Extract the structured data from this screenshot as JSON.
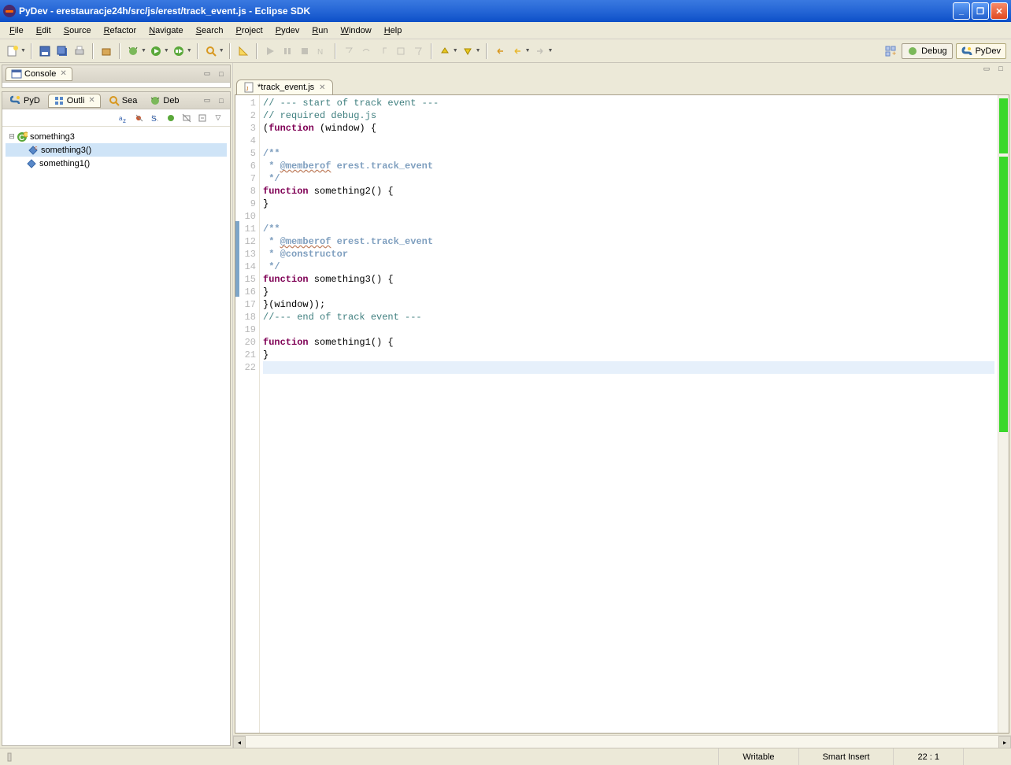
{
  "title": "PyDev - erestauracje24h/src/js/erest/track_event.js - Eclipse SDK",
  "menu": [
    "File",
    "Edit",
    "Source",
    "Refactor",
    "Navigate",
    "Search",
    "Project",
    "Pydev",
    "Run",
    "Window",
    "Help"
  ],
  "perspectives": {
    "debug": "Debug",
    "pydev": "PyDev"
  },
  "leftTop": {
    "tab": "Console"
  },
  "leftBottom": {
    "tabs": [
      "PyD",
      "Outli",
      "Sea",
      "Deb"
    ],
    "activeTab": 1,
    "tree": {
      "root": {
        "label": "something3",
        "expanded": true
      },
      "children": [
        {
          "label": "something3()",
          "selected": true,
          "kind": "constructor"
        },
        {
          "label": "something1()",
          "kind": "member"
        }
      ]
    }
  },
  "editor": {
    "tab": "*track_event.js",
    "lines": 22,
    "changed": [
      11,
      12,
      13,
      14,
      15,
      16
    ],
    "currentLine": 22,
    "code": [
      {
        "t": "cmt",
        "s": "// --- start of track event ---"
      },
      {
        "t": "cmt",
        "s": "// required debug.js"
      },
      {
        "t": "mix",
        "p": [
          [
            "",
            "("
          ],
          [
            "kw",
            "function"
          ],
          [
            "",
            " (window) {"
          ]
        ]
      },
      {
        "t": "",
        "s": ""
      },
      {
        "t": "jtag",
        "s": "/**"
      },
      {
        "t": "mix",
        "p": [
          [
            "jtag",
            " * "
          ],
          [
            "jtag-bad",
            "@memberof"
          ],
          [
            "jtag",
            " erest.track_event"
          ]
        ]
      },
      {
        "t": "jtag",
        "s": " */"
      },
      {
        "t": "mix",
        "p": [
          [
            "kw",
            "function"
          ],
          [
            "",
            " something2() {"
          ]
        ]
      },
      {
        "t": "",
        "s": "}"
      },
      {
        "t": "",
        "s": ""
      },
      {
        "t": "jtag",
        "s": "/**"
      },
      {
        "t": "mix",
        "p": [
          [
            "jtag",
            " * "
          ],
          [
            "jtag-bad",
            "@memberof"
          ],
          [
            "jtag",
            " erest.track_event"
          ]
        ]
      },
      {
        "t": "mix",
        "p": [
          [
            "jtag",
            " * "
          ],
          [
            "jtag",
            "@constructor"
          ]
        ]
      },
      {
        "t": "jtag",
        "s": " */"
      },
      {
        "t": "mix",
        "p": [
          [
            "kw",
            "function"
          ],
          [
            "",
            " something3() {"
          ]
        ]
      },
      {
        "t": "",
        "s": "}"
      },
      {
        "t": "",
        "s": "}(window));"
      },
      {
        "t": "cmt",
        "s": "//--- end of track event ---"
      },
      {
        "t": "",
        "s": ""
      },
      {
        "t": "mix",
        "p": [
          [
            "kw",
            "function"
          ],
          [
            "",
            " something1() {"
          ]
        ]
      },
      {
        "t": "",
        "s": "}"
      },
      {
        "t": "",
        "s": ""
      }
    ]
  },
  "status": {
    "writable": "Writable",
    "insert": "Smart Insert",
    "pos": "22 : 1"
  }
}
